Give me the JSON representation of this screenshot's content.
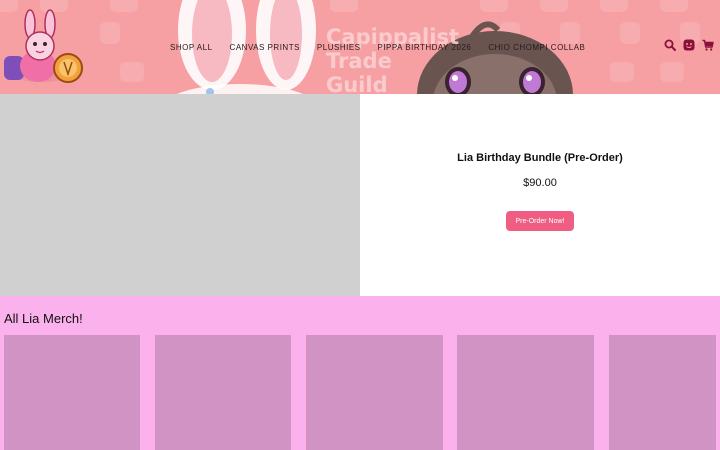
{
  "header": {
    "banner_text": [
      "Capippalist",
      "Trade",
      "Guild"
    ],
    "nav": [
      {
        "label": "SHOP ALL"
      },
      {
        "label": "CANVAS PRINTS"
      },
      {
        "label": "PLUSHIES"
      },
      {
        "label": "PIPPA BIRTHDAY 2026"
      },
      {
        "label": "CHIO CHOMPI COLLAB"
      }
    ],
    "icons": [
      "search-icon",
      "account-icon",
      "cart-icon"
    ],
    "background_color": "#f6a0a4",
    "icon_color": "#8a0f3a"
  },
  "product": {
    "title": "Lia Birthday Bundle (Pre-Order)",
    "price": "$90.00",
    "button_label": "Pre-Order Now!",
    "button_color": "#ef5d83"
  },
  "merch": {
    "title": "All Lia Merch!",
    "background_color": "#fbb2ec",
    "card_color": "#d193c4",
    "card_count": 5
  }
}
